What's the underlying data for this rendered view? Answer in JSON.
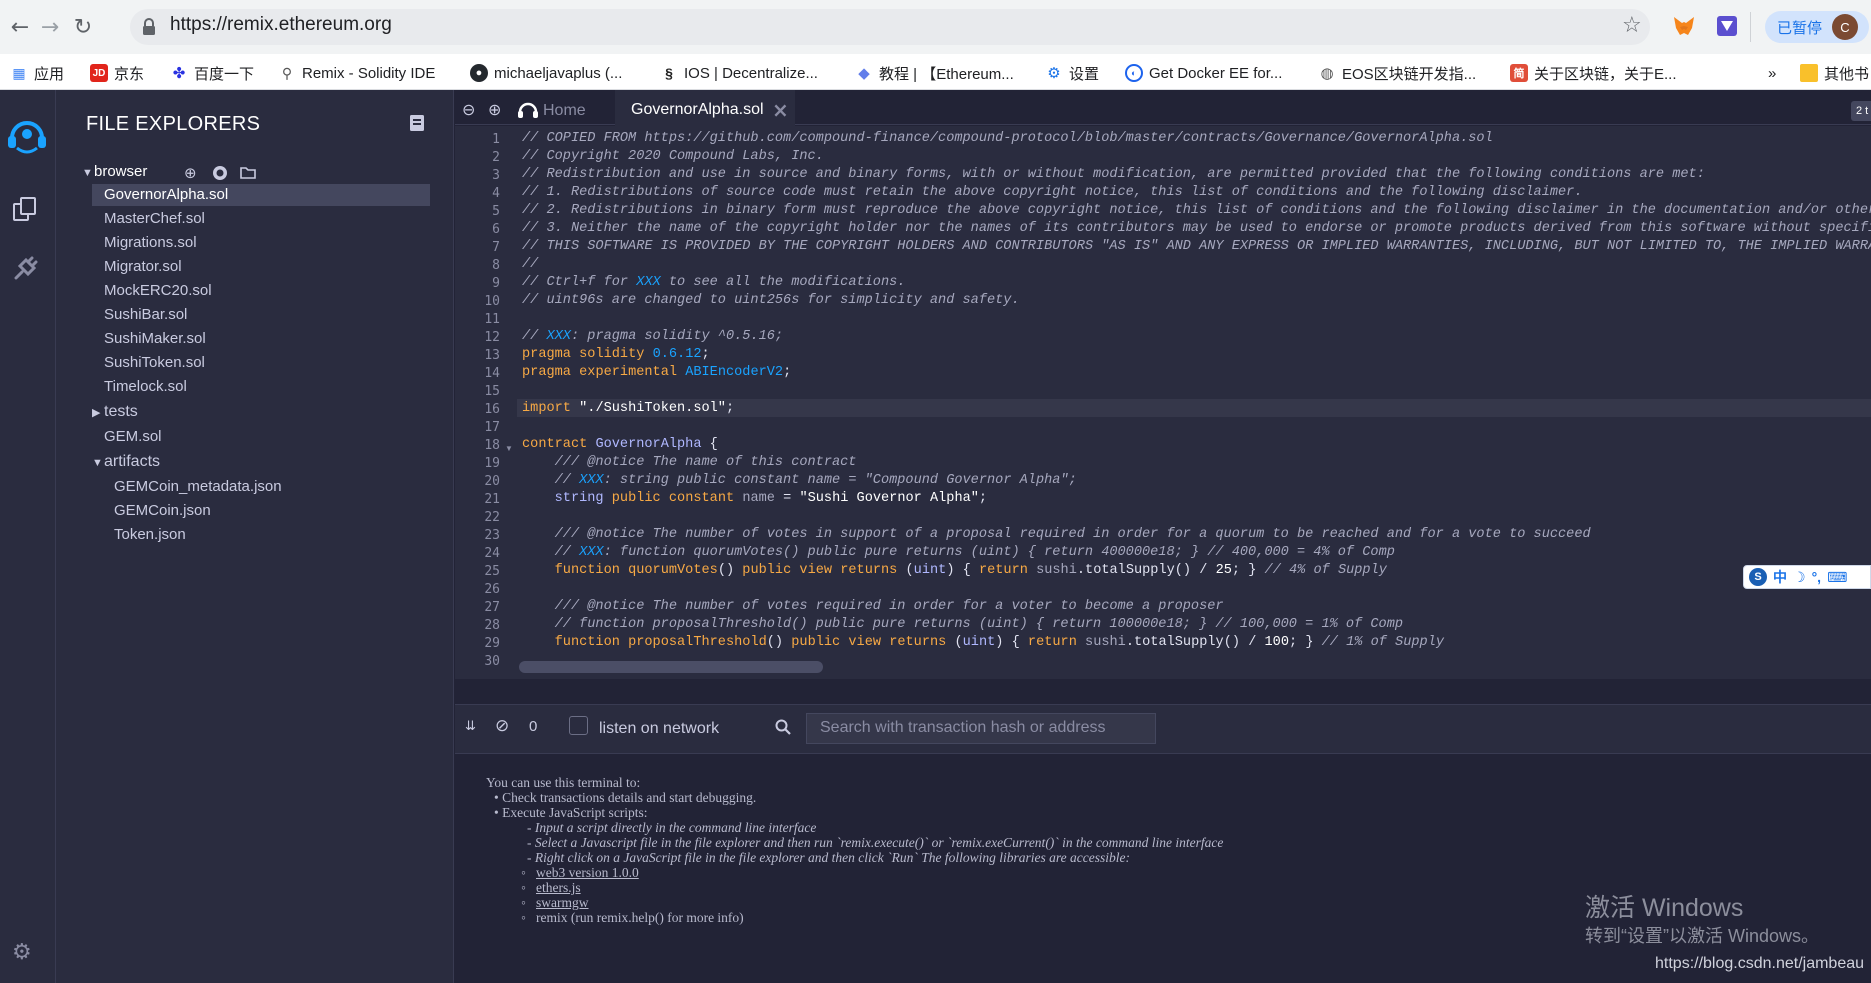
{
  "browser": {
    "url": "https://remix.ethereum.org",
    "paused_label": "已暂停",
    "avatar_letter": "C",
    "bookmarks": [
      "应用",
      "京东",
      "百度一下",
      "Remix - Solidity IDE",
      "michaeljavaplus (...",
      "IOS | Decentralize...",
      "教程 | 【Ethereum...",
      "设置",
      "Get Docker EE for...",
      "EOS区块链开发指...",
      "关于区块链，关于E...",
      "»",
      "其他书"
    ]
  },
  "file_explorer": {
    "title": "FILE EXPLORERS",
    "root": "browser",
    "files": [
      "GovernorAlpha.sol",
      "MasterChef.sol",
      "Migrations.sol",
      "Migrator.sol",
      "MockERC20.sol",
      "SushiBar.sol",
      "SushiMaker.sol",
      "SushiToken.sol",
      "Timelock.sol"
    ],
    "selected": "GovernorAlpha.sol",
    "tests_folder": "tests",
    "gem_file": "GEM.sol",
    "artifacts_folder": "artifacts",
    "artifact_files": [
      "GEMCoin_metadata.json",
      "GEMCoin.json",
      "Token.json"
    ]
  },
  "tabs": {
    "home": "Home",
    "active": "GovernorAlpha.sol",
    "right_badge": "2 t"
  },
  "editor": {
    "line_numbers": [
      "1",
      "2",
      "3",
      "4",
      "5",
      "6",
      "7",
      "8",
      "9",
      "10",
      "11",
      "12",
      "13",
      "14",
      "15",
      "16",
      "17",
      "18",
      "19",
      "20",
      "21",
      "22",
      "23",
      "24",
      "25",
      "26",
      "27",
      "28",
      "29",
      "30"
    ]
  },
  "terminal": {
    "count": "0",
    "listen_label": "listen on network",
    "search_placeholder": "Search with transaction hash or address",
    "lines": [
      "You can use this terminal to:",
      "• Check transactions details and start debugging.",
      "• Execute JavaScript scripts:",
      "- Input a script directly in the command line interface",
      "- Select a Javascript file in the file explorer and then run `remix.execute()` or `remix.exeCurrent()` in the command line interface",
      "- Right click on a JavaScript file in the file explorer and then click `Run` The following libraries are accessible:",
      "web3 version 1.0.0",
      "ethers.js",
      "swarmgw",
      "remix (run remix.help() for more info)"
    ]
  },
  "watermark": {
    "line1": "激活 Windows",
    "line2": "转到“设置”以激活 Windows。",
    "blog": "https://blog.csdn.net/jambeau"
  }
}
